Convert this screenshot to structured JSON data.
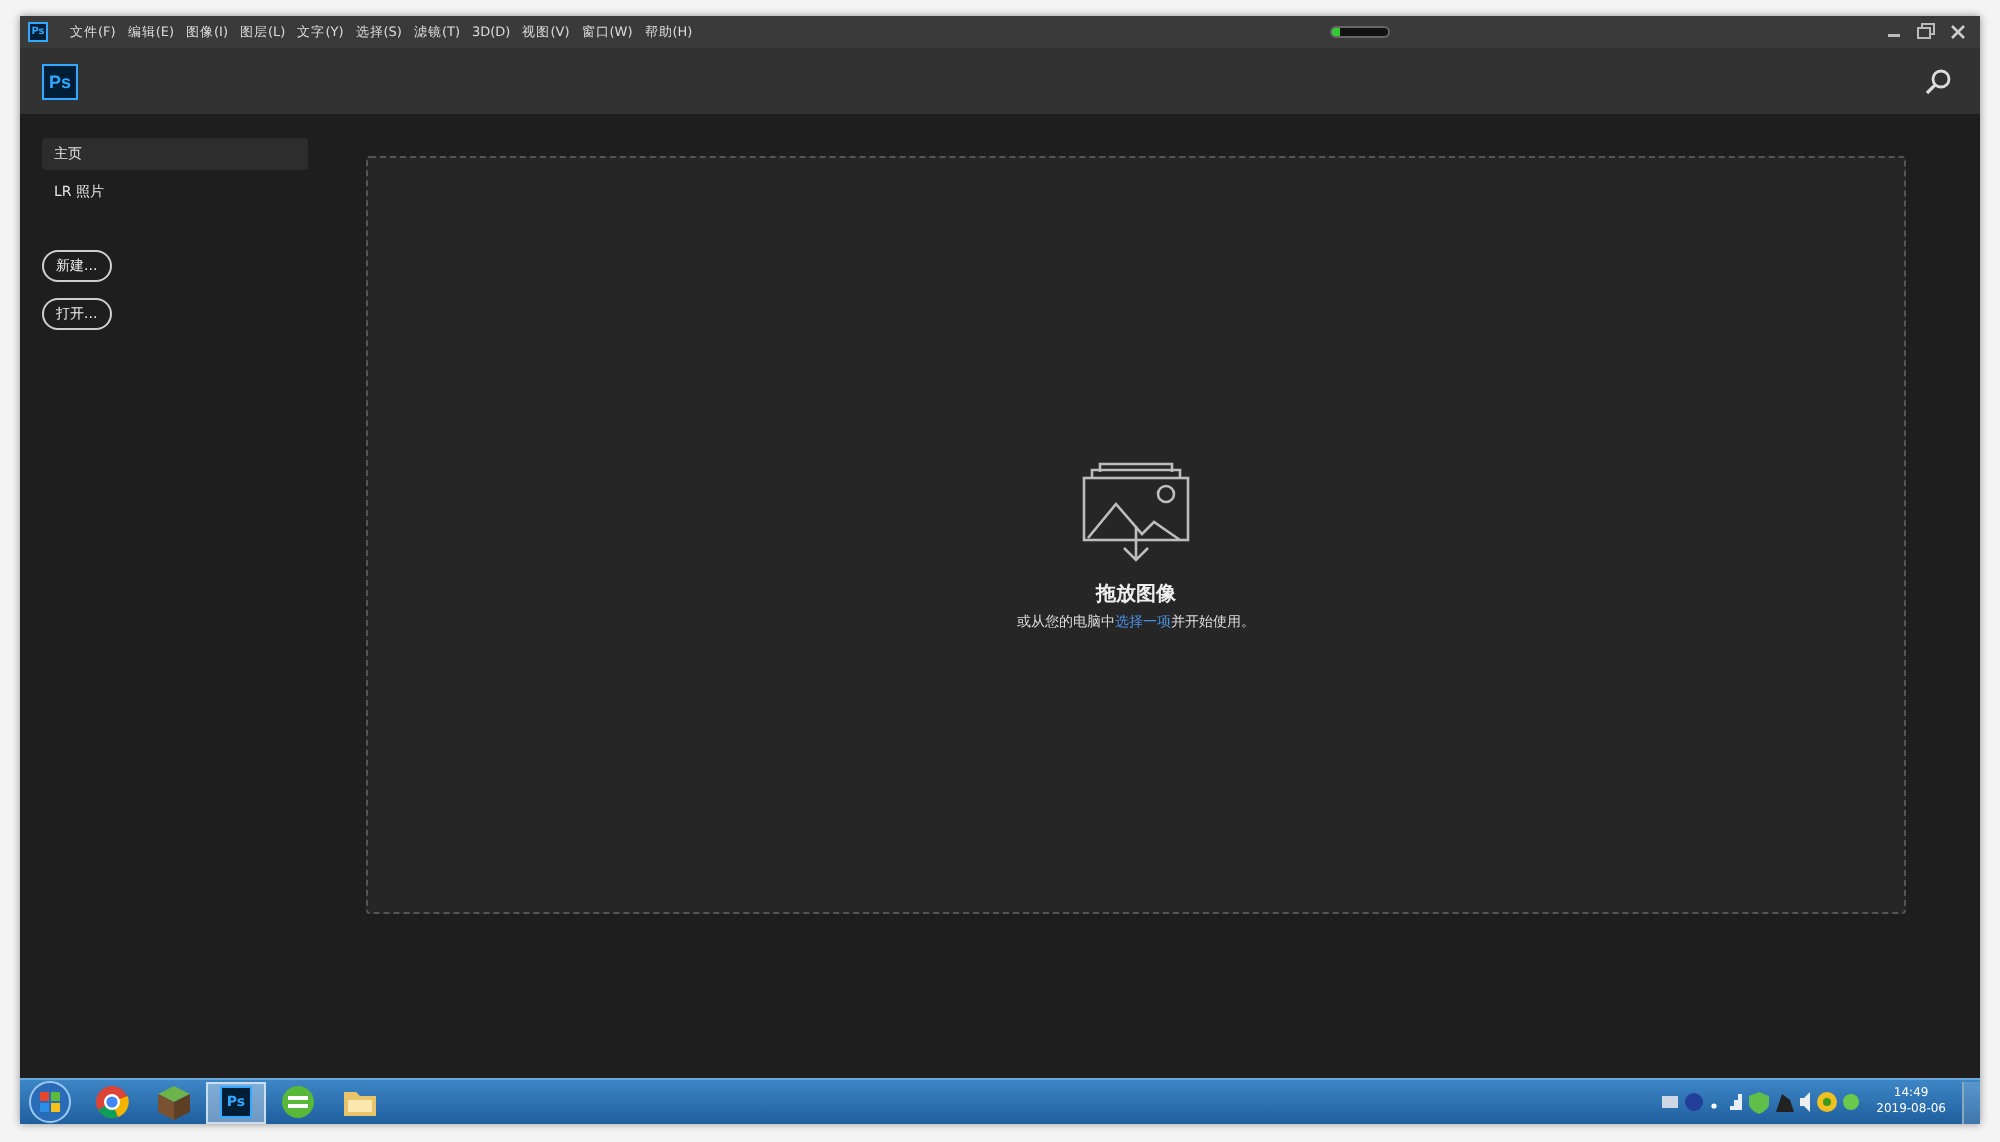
{
  "menu_bar": {
    "app_icon": "Ps",
    "items": [
      "文件(F)",
      "编辑(E)",
      "图像(I)",
      "图层(L)",
      "文字(Y)",
      "选择(S)",
      "滤镜(T)",
      "3D(D)",
      "视图(V)",
      "窗口(W)",
      "帮助(H)"
    ]
  },
  "header": {
    "logo": "Ps"
  },
  "sidebar": {
    "nav": [
      {
        "label": "主页",
        "selected": true
      },
      {
        "label": "LR 照片",
        "selected": false
      }
    ],
    "buttons": [
      "新建...",
      "打开..."
    ]
  },
  "drop_zone": {
    "title": "拖放图像",
    "before_link": "或从您的电脑中",
    "link": "选择一项",
    "after_link": "并开始使用。"
  },
  "taskbar": {
    "apps": [
      {
        "kind": "start",
        "active": false
      },
      {
        "kind": "chrome",
        "active": false
      },
      {
        "kind": "block",
        "active": false
      },
      {
        "kind": "ps",
        "label": "Ps",
        "active": true
      },
      {
        "kind": "refresh",
        "active": false
      },
      {
        "kind": "folder",
        "active": false
      }
    ],
    "time": "14:49",
    "date": "2019-08-06"
  }
}
